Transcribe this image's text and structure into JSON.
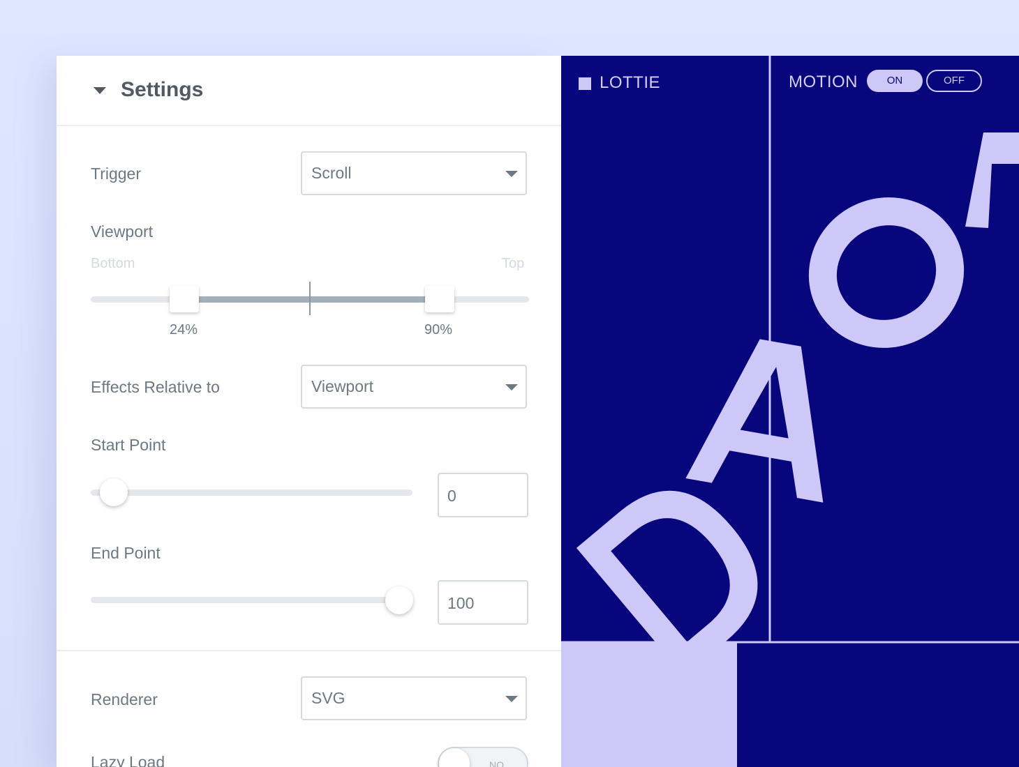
{
  "settings": {
    "title": "Settings",
    "trigger": {
      "label": "Trigger",
      "value": "Scroll"
    },
    "viewport": {
      "label": "Viewport",
      "bottom_label": "Bottom",
      "top_label": "Top",
      "start_pct": "24%",
      "end_pct": "90%",
      "start_value": 24,
      "end_value": 90
    },
    "effects_relative": {
      "label": "Effects Relative to",
      "value": "Viewport"
    },
    "start_point": {
      "label": "Start Point",
      "value": "0",
      "slider_value": 0
    },
    "end_point": {
      "label": "End Point",
      "value": "100",
      "slider_value": 100
    },
    "renderer": {
      "label": "Renderer",
      "value": "SVG"
    },
    "lazy_load": {
      "label": "Lazy Load",
      "toggle_label": "NO",
      "state": "off"
    }
  },
  "preview": {
    "lottie_label": "LOTTIE",
    "motion_label": "MOTION",
    "on_label": "ON",
    "off_label": "OFF",
    "colors": {
      "background": "#07067c",
      "accent": "#cec8f8"
    },
    "letters": [
      "D",
      "A",
      "O",
      "L"
    ]
  }
}
